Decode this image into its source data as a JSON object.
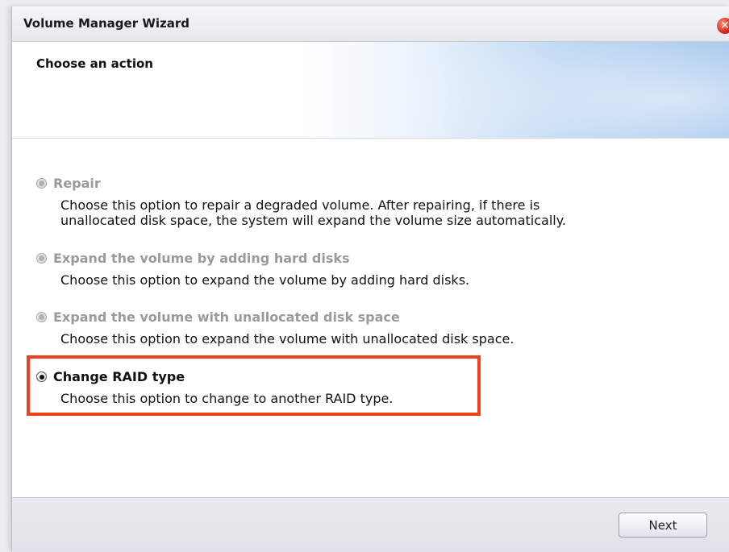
{
  "window": {
    "title": "Volume Manager Wizard",
    "close_icon": "close-icon",
    "close_symbol": "✕"
  },
  "header": {
    "title": "Choose an action"
  },
  "options": [
    {
      "label": "Repair",
      "description": "Choose this option to repair a degraded volume. After repairing, if there is\nunallocated disk space, the system will expand the volume size automatically.",
      "state": "disabled"
    },
    {
      "label": "Expand the volume by adding hard disks",
      "description": "Choose this option to expand the volume by adding hard disks.",
      "state": "disabled"
    },
    {
      "label": "Expand the volume with unallocated disk space",
      "description": "Choose this option to expand the volume with unallocated disk space.",
      "state": "disabled"
    },
    {
      "label": "Change RAID type",
      "description": "Choose this option to change to another RAID type.",
      "state": "selected"
    }
  ],
  "highlight": {
    "color": "#f0401a"
  },
  "footer": {
    "next_label": "Next"
  }
}
